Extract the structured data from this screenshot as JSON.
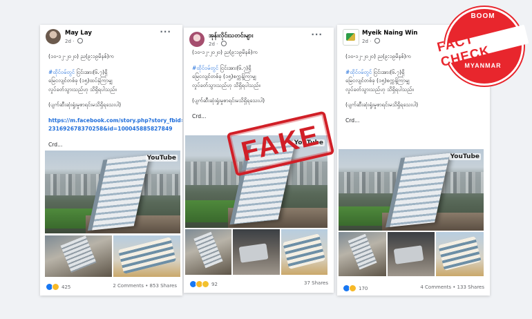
{
  "posts": [
    {
      "author": "May Lay",
      "time": "2d",
      "date_line": "(၁၀-၁၂-၂၀၂၀) ည(၉:၁၉မိနစ်)က",
      "hashtag": "#ထိုင်ဝမ်တွင်",
      "line1": " ငြင်းအား(၆.၇)ရှိ",
      "line2": "မြေငလျင်တစ်ခု (၁၅)ထပ်နှံကြာမျှ",
      "line3": "လှုပ်ခတ်သွားသည်ဟု သိရှိရပါသည်။",
      "casualty_line": "(ပျက်ဆီးဆုံးရှုံးမှုစာရင်းမသိရှိရသေးပါ)",
      "link_line1": "https://m.facebook.com/story.php?story_fbid=",
      "link_line2": "231692678370258&id=100045885827849",
      "credit": "Crd...",
      "watermark": "YouTube",
      "reaction_count": "425",
      "comments": "2 Comments",
      "shares": "853 Shares",
      "shares_text": "2 Comments • 853 Shares"
    },
    {
      "author": "အုန်းလိုင်းသတင်းများ",
      "time": "2d",
      "date_line": "(၁၀-၁၂-၂၀၂၀) ည(၉:၁၉မိနစ်)က",
      "hashtag": "#ထိုင်ဝမ်တွင်",
      "line1": " ငြင်းအား(၆.၇)ရှိ",
      "line2": "မြေငလျင်တစ်ခု (၁၅)စက္ကန့်ကြာမျှ",
      "line3": "လှုပ်ခတ်သွားသည်ဟု သိရှိရပါသည်။",
      "casualty_line": "(ပျက်ဆီးဆုံးရှုံးမှုစာရင်းမသိရှိရသေးပါ)",
      "credit": "Crd...",
      "watermark": "YouTube",
      "reaction_count": "92",
      "shares_text": "37 Shares"
    },
    {
      "author": "Myeik Naing Win",
      "time": "2d",
      "date_line": "(၁၀-၁၂-၂၀၂၀) ည(၉:၁၉မိနစ်)က",
      "hashtag": "#ထိုင်ဝမ်တွင်",
      "line1": " ငြင်းအား(၆.၇)ရှိ",
      "line2": "မြေငလျင်တစ်ခု (၁၅)စက္ကန့်ကြာမျှ",
      "line3": "လှုပ်ခတ်သွားသည်ဟု သိရှိရပါသည်။",
      "casualty_line": "(ပျက်ဆီးဆုံးရှုံးမှုစာရင်းမသိရှိရသေးပါ)",
      "credit": "Crd...",
      "watermark": "YouTube",
      "reaction_count": "170",
      "shares_text": "4 Comments • 133 Shares"
    }
  ],
  "stamp": {
    "text": "FAKE"
  },
  "badge": {
    "top": "BOOM",
    "main": "FACT CHECK",
    "bottom": "MYANMAR"
  },
  "colors": {
    "link": "#216fdb",
    "stamp_red": "#d11f27",
    "badge_red": "#e8262d",
    "like_blue": "#1877f2"
  },
  "icons": {
    "more": "more-options-icon",
    "privacy": "globe-icon"
  }
}
